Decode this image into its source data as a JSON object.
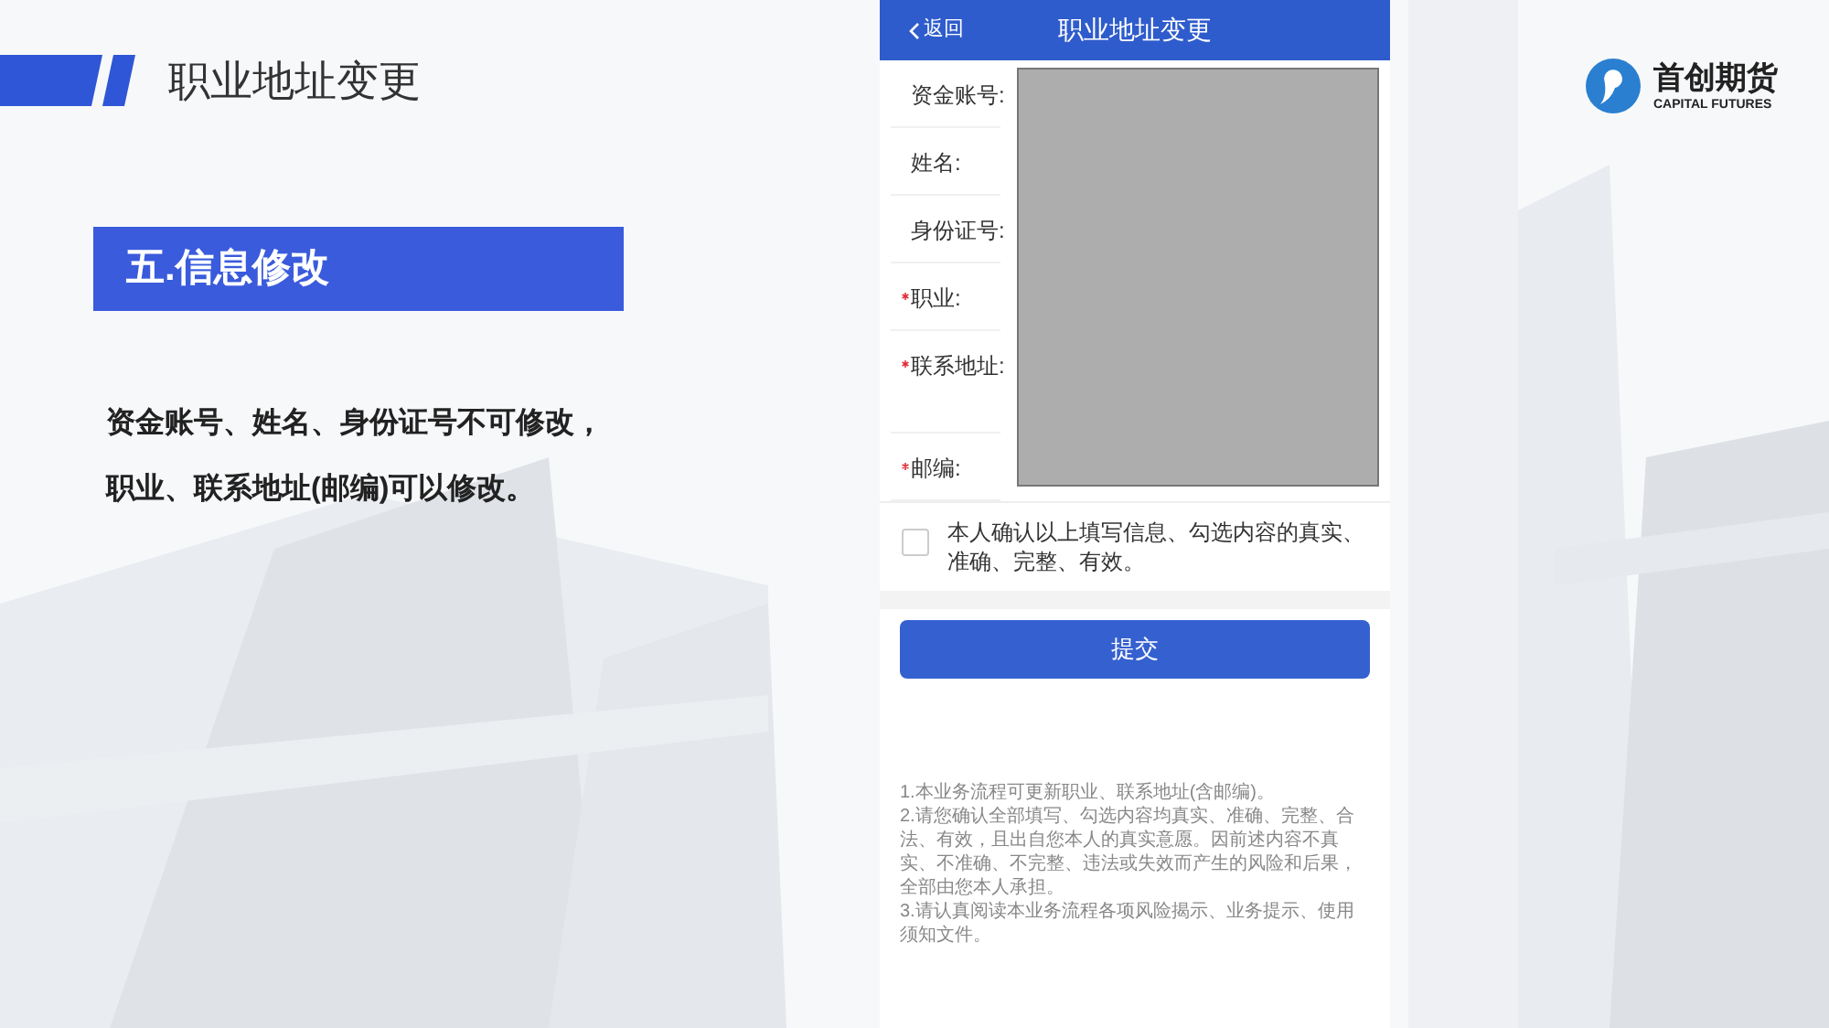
{
  "slide": {
    "title": "职业地址变更",
    "section": "五.信息修改",
    "body": [
      "资金账号、姓名、身份证号不可修改，",
      "职业、联系地址(邮编)可以修改。"
    ]
  },
  "logo": {
    "name": "首创期货",
    "subtitle": "CAPITAL FUTURES"
  },
  "phone": {
    "back": "返回",
    "title": "职业地址变更",
    "fields": [
      {
        "label": "资金账号:",
        "required": false,
        "tall": false
      },
      {
        "label": "姓名:",
        "required": false,
        "tall": false
      },
      {
        "label": "身份证号:",
        "required": false,
        "tall": false
      },
      {
        "label": "职业:",
        "required": true,
        "tall": false
      },
      {
        "label": "联系地址:",
        "required": true,
        "tall": true
      },
      {
        "label": "邮编:",
        "required": true,
        "tall": false
      }
    ],
    "confirm": {
      "text": "本人确认以上填写信息、勾选内容的真实、准确、完整、有效。",
      "checked": false
    },
    "submit": "提交",
    "notes": [
      "1.本业务流程可更新职业、联系地址(含邮编)。",
      "2.请您确认全部填写、勾选内容均真实、准确、完整、合法、有效，且出自您本人的真实意愿。因前述内容不真实、不准确、不完整、违法或失效而产生的风险和后果，全部由您本人承担。",
      "3.请认真阅读本业务流程各项风险揭示、业务提示、使用须知文件。"
    ]
  }
}
